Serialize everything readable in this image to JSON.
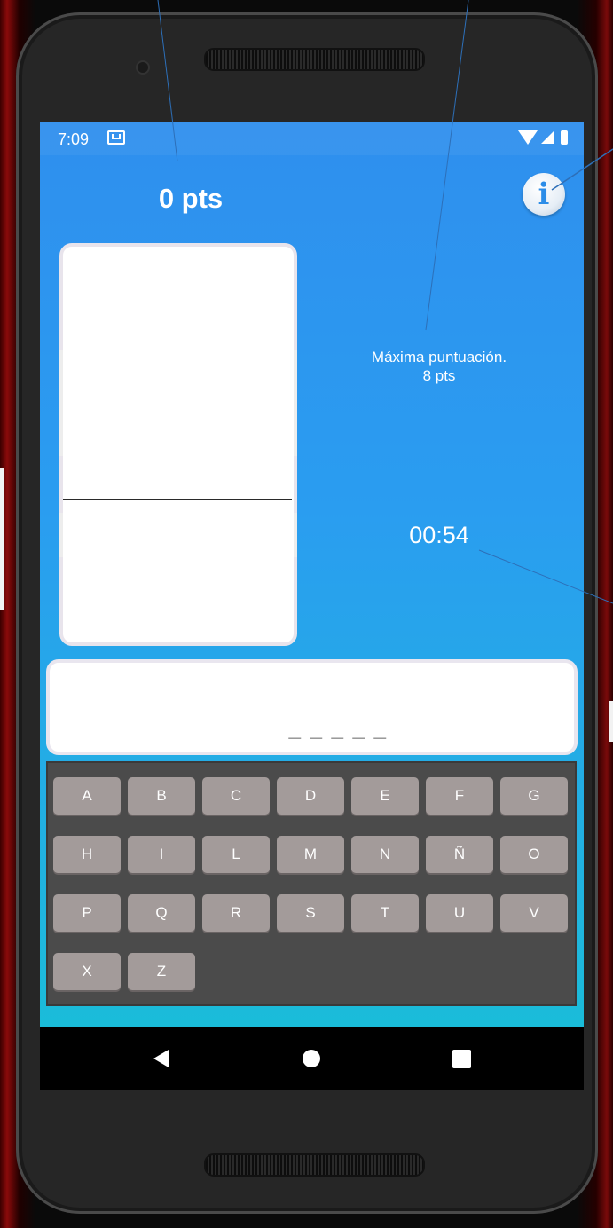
{
  "status_bar": {
    "time": "7:09",
    "mail_icon": "mail-icon",
    "wifi_icon": "wifi-icon",
    "signal_icon": "signal-icon",
    "battery_icon": "battery-icon"
  },
  "game": {
    "score": "0 pts",
    "high_score_label": "Máxima puntuación.",
    "high_score_value": "8 pts",
    "timer": "00:54",
    "word_mask": "_ _ _ _ _"
  },
  "info_button": {
    "glyph": "i",
    "icon": "info-icon"
  },
  "keyboard": {
    "keys": [
      "A",
      "B",
      "C",
      "D",
      "E",
      "F",
      "G",
      "H",
      "I",
      "L",
      "M",
      "N",
      "Ñ",
      "O",
      "P",
      "Q",
      "R",
      "S",
      "T",
      "U",
      "V",
      "X",
      "Z"
    ]
  },
  "navigation": {
    "back_icon": "back-icon",
    "home_icon": "home-icon",
    "recents_icon": "recents-icon"
  },
  "colors": {
    "accent": "#2a9df0",
    "key_bg": "#a39b9a",
    "keyboard_bg": "#4b4b4b"
  }
}
